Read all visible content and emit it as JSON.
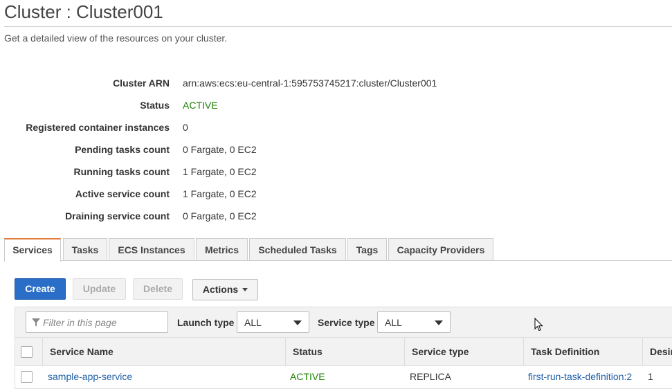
{
  "page": {
    "title": "Cluster : Cluster001",
    "subtitle": "Get a detailed view of the resources on your cluster."
  },
  "details": [
    {
      "label": "Cluster ARN",
      "value": "arn:aws:ecs:eu-central-1:595753745217:cluster/Cluster001"
    },
    {
      "label": "Status",
      "value": "ACTIVE"
    },
    {
      "label": "Registered container instances",
      "value": "0"
    },
    {
      "label": "Pending tasks count",
      "value": "0 Fargate, 0 EC2"
    },
    {
      "label": "Running tasks count",
      "value": "1 Fargate, 0 EC2"
    },
    {
      "label": "Active service count",
      "value": "1 Fargate, 0 EC2"
    },
    {
      "label": "Draining service count",
      "value": "0 Fargate, 0 EC2"
    }
  ],
  "tabs": [
    "Services",
    "Tasks",
    "ECS Instances",
    "Metrics",
    "Scheduled Tasks",
    "Tags",
    "Capacity Providers"
  ],
  "active_tab": "Services",
  "toolbar": {
    "create": "Create",
    "update": "Update",
    "delete": "Delete",
    "actions": "Actions"
  },
  "filters": {
    "search_placeholder": "Filter in this page",
    "launch_type_label": "Launch type",
    "launch_type_value": "ALL",
    "service_type_label": "Service type",
    "service_type_value": "ALL"
  },
  "table": {
    "columns": [
      "Service Name",
      "Status",
      "Service type",
      "Task Definition",
      "Desir"
    ],
    "rows": [
      {
        "service_name": "sample-app-service",
        "status": "ACTIVE",
        "service_type": "REPLICA",
        "task_definition": "first-run-task-definition:2",
        "desired": "1"
      }
    ]
  },
  "colors": {
    "accent_tab": "#e07b39",
    "primary_button": "#2a6ec7",
    "status_active": "#1d8102",
    "link": "#1f5fa8"
  },
  "icons": {
    "filter": "filter-icon",
    "dropdown": "chevron-down-icon",
    "cursor": "mouse-pointer-icon"
  }
}
